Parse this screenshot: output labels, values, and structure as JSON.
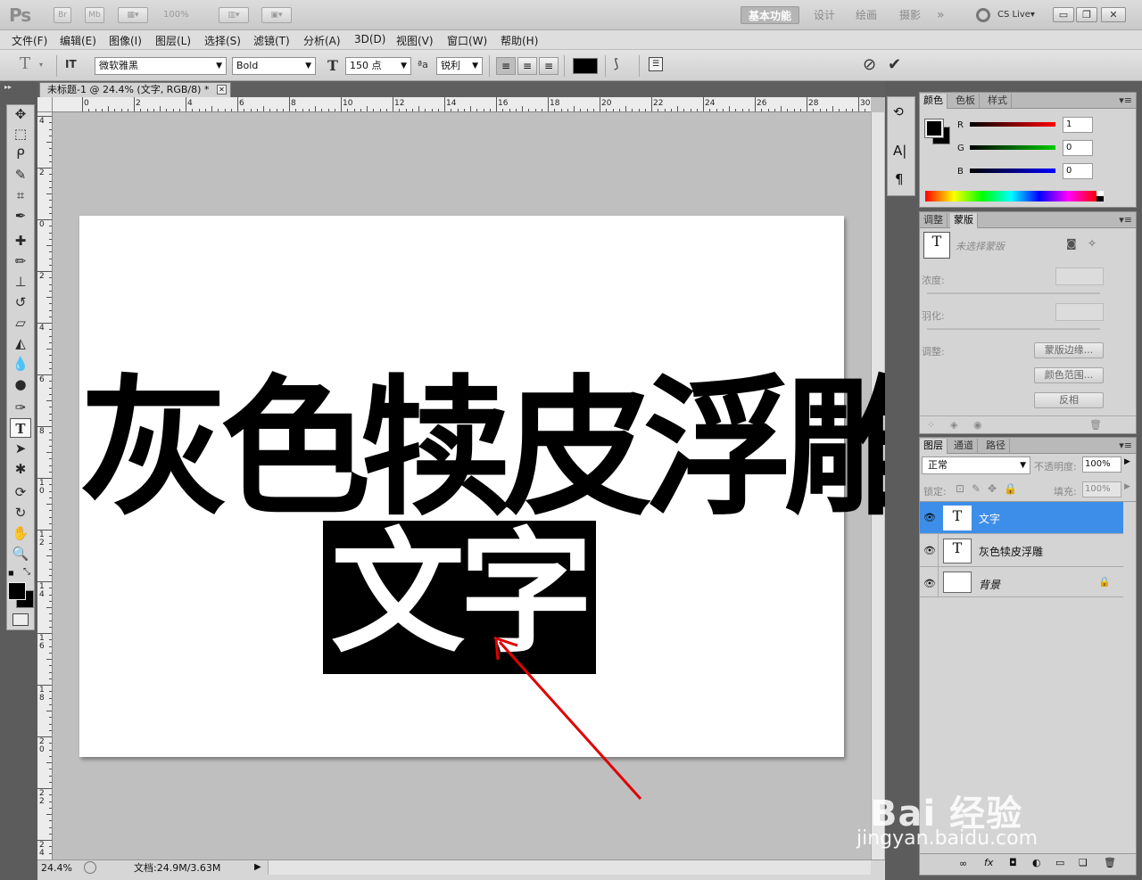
{
  "app": {
    "logo": "Ps",
    "bridge_btn": "Br",
    "minibridge_btn": "Mb",
    "zoom_display": "100%",
    "workspaces": [
      "基本功能",
      "设计",
      "绘画",
      "摄影"
    ],
    "more": "»",
    "cs_live": "CS Live▾",
    "window_controls": [
      "▭",
      "❐",
      "✕"
    ]
  },
  "menu": [
    "文件(F)",
    "编辑(E)",
    "图像(I)",
    "图层(L)",
    "选择(S)",
    "滤镜(T)",
    "分析(A)",
    "3D(D)",
    "视图(V)",
    "窗口(W)",
    "帮助(H)"
  ],
  "options": {
    "tool_glyph": "T",
    "orient_glyph": "IT",
    "font_family": "微软雅黑",
    "font_style": "Bold",
    "size_glyph": "T",
    "font_size": "150 点",
    "aa_glyph": "ªa",
    "antialias": "锐利",
    "cancel_glyph": "⊘",
    "commit_glyph": "✔"
  },
  "document": {
    "tab_title": "未标题-1 @ 24.4% (文字, RGB/8) *",
    "tab_close": "✕",
    "ruler_top_labels": [
      "0",
      "2",
      "4",
      "6",
      "8",
      "10",
      "12",
      "14",
      "16",
      "18",
      "20",
      "22",
      "24",
      "26",
      "28",
      "30"
    ],
    "ruler_left_labels": [
      "4",
      "2",
      "0",
      "2",
      "4",
      "6",
      "8",
      "1 0",
      "1 2",
      "1 4",
      "1 6",
      "1 8",
      "2 0",
      "2 2",
      "2 4"
    ],
    "main_text": "灰色犊皮浮雕",
    "selected_text": "文字"
  },
  "status": {
    "zoom": "24.4%",
    "doc_info": "文档:24.9M/3.63M"
  },
  "panels": {
    "color": {
      "tabs": [
        "颜色",
        "色板",
        "样式"
      ],
      "channels": [
        {
          "label": "R",
          "value": "1"
        },
        {
          "label": "G",
          "value": "0"
        },
        {
          "label": "B",
          "value": "0"
        }
      ]
    },
    "masks": {
      "tabs": [
        "调整",
        "蒙版"
      ],
      "no_mask": "未选择蒙版",
      "density_label": "浓度:",
      "feather_label": "羽化:",
      "refine_label": "调整:",
      "buttons": [
        "蒙版边缘...",
        "颜色范围...",
        "反相"
      ]
    },
    "layers": {
      "tabs": [
        "图层",
        "通道",
        "路径"
      ],
      "blend_mode": "正常",
      "opacity_label": "不透明度:",
      "opacity": "100%",
      "lock_label": "锁定:",
      "fill_label": "填充:",
      "fill": "100%",
      "items": [
        {
          "name": "文字",
          "thumb": "T",
          "selected": true
        },
        {
          "name": "灰色犊皮浮雕",
          "thumb": "T",
          "selected": false
        },
        {
          "name": "背景",
          "thumb": "",
          "selected": false
        }
      ],
      "footer_icons": [
        "∞",
        "fx",
        "◘",
        "◐",
        "▭",
        "❏",
        "🗑"
      ]
    }
  },
  "watermark": {
    "brand": "Bai 经验",
    "url": "jingyan.baidu.com"
  }
}
